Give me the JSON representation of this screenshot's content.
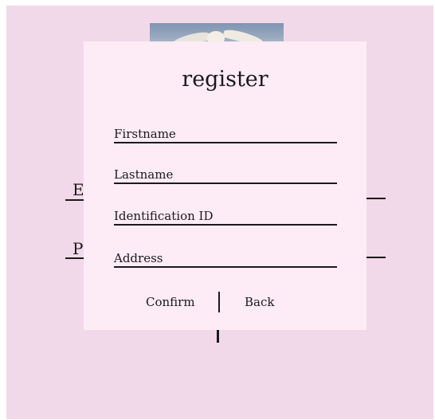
{
  "background": {
    "label_e": "E",
    "label_p": "P"
  },
  "modal": {
    "title": "register",
    "fields": [
      {
        "label": "Firstname"
      },
      {
        "label": "Lastname"
      },
      {
        "label": "Identification ID"
      },
      {
        "label": "Address"
      }
    ],
    "confirm_label": "Confirm",
    "back_label": "Back"
  }
}
